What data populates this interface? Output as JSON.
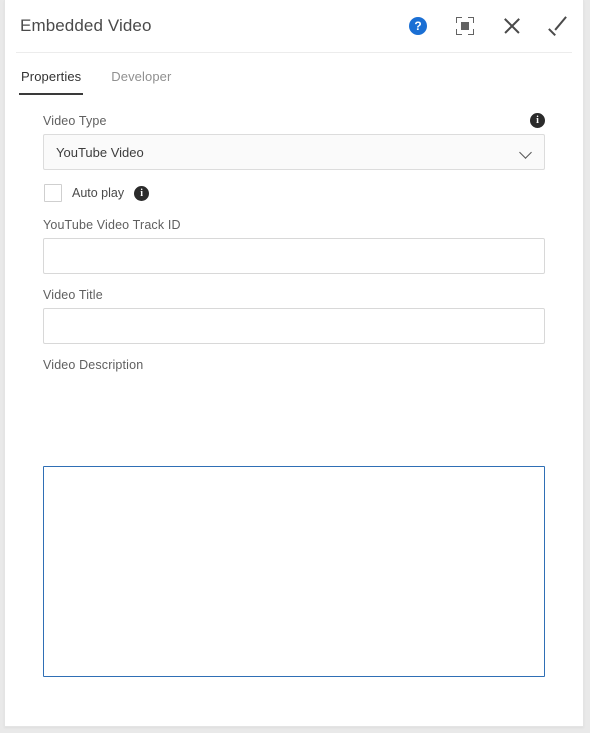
{
  "window": {
    "title": "Embedded Video",
    "background_color": "#e9e9e9",
    "panel_color": "#ffffff"
  },
  "header": {
    "title": "Embedded Video",
    "actions": [
      {
        "name": "help",
        "icon": "help-circle-icon",
        "glyph": "?",
        "color": "#1a6fd4"
      },
      {
        "name": "maximize",
        "icon": "maximize-icon",
        "color": "#636363"
      },
      {
        "name": "close",
        "icon": "close-icon",
        "glyph": "×",
        "color": "#4a4a4a"
      },
      {
        "name": "confirm",
        "icon": "check-icon",
        "glyph": "✓",
        "color": "#4a4a4a"
      }
    ]
  },
  "tabs": [
    {
      "label": "Properties",
      "active": true
    },
    {
      "label": "Developer",
      "active": false
    }
  ],
  "form": {
    "video_type": {
      "label": "Video Type",
      "info_icon": "info-icon",
      "info_glyph": "i",
      "selected": "YouTube Video",
      "options": [
        "YouTube Video"
      ],
      "chevron": "chevron-down-icon"
    },
    "auto_play": {
      "label": "Auto play",
      "checked": false,
      "info_icon": "info-icon",
      "info_glyph": "i"
    },
    "track_id": {
      "label": "YouTube Video Track ID",
      "value": "",
      "placeholder": ""
    },
    "video_title": {
      "label": "Video Title",
      "value": "",
      "placeholder": ""
    },
    "video_description": {
      "label": "Video Description",
      "value": "",
      "focused": true,
      "border_color": "#2f6fb5"
    }
  }
}
